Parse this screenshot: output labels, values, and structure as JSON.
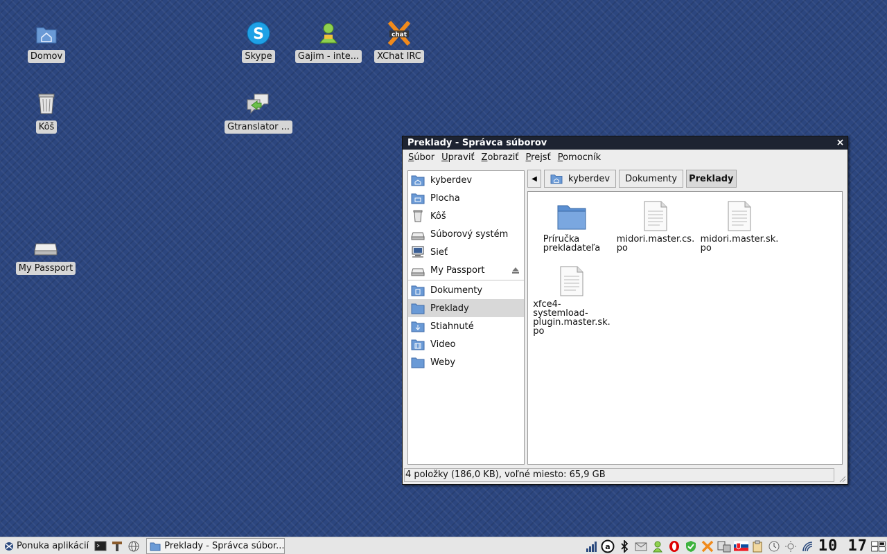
{
  "desktop": {
    "icons": [
      {
        "label": "Domov"
      },
      {
        "label": "Kôš"
      },
      {
        "label": "My Passport"
      },
      {
        "label": "Skype"
      },
      {
        "label": "Gtranslator ..."
      },
      {
        "label": "Gajim - inte..."
      },
      {
        "label": "XChat IRC"
      }
    ]
  },
  "window": {
    "title": "Preklady - Správca súborov",
    "close_glyph": "×",
    "menu": [
      {
        "underline": "S",
        "rest": "úbor"
      },
      {
        "underline": "U",
        "rest": "praviť"
      },
      {
        "underline": "Z",
        "rest": "obraziť"
      },
      {
        "underline": "P",
        "rest": "rejsť"
      },
      {
        "underline": "P",
        "rest": "omocník"
      }
    ],
    "sidebar": {
      "places": [
        {
          "label": "kyberdev",
          "icon": "home-folder-icon"
        },
        {
          "label": "Plocha",
          "icon": "desktop-folder-icon"
        },
        {
          "label": "Kôš",
          "icon": "trash-icon"
        },
        {
          "label": "Súborový systém",
          "icon": "drive-icon"
        },
        {
          "label": "Sieť",
          "icon": "network-icon"
        },
        {
          "label": "My Passport",
          "icon": "drive-icon"
        }
      ],
      "bookmarks": [
        {
          "label": "Dokumenty",
          "icon": "documents-folder-icon"
        },
        {
          "label": "Preklady",
          "icon": "folder-icon",
          "selected": true
        },
        {
          "label": "Stiahnuté",
          "icon": "downloads-folder-icon"
        },
        {
          "label": "Video",
          "icon": "video-folder-icon"
        },
        {
          "label": "Weby",
          "icon": "folder-icon"
        }
      ]
    },
    "pathbar": {
      "back_glyph": "◀",
      "crumbs": [
        "kyberdev",
        "Dokumenty",
        "Preklady"
      ]
    },
    "files": [
      {
        "name_lines": [
          "Príručka",
          "prekladateľa"
        ],
        "type": "folder"
      },
      {
        "name_lines": [
          "midori.master.cs.",
          "po"
        ],
        "type": "file"
      },
      {
        "name_lines": [
          "midori.master.sk.",
          "po"
        ],
        "type": "file"
      },
      {
        "name_lines": [
          "xfce4-",
          "systemload-",
          "plugin.master.sk.",
          "po"
        ],
        "type": "file"
      }
    ],
    "status": "4 položky (186,0 KB), voľné miesto: 65,9 GB"
  },
  "taskbar": {
    "app_menu_label": "Ponuka aplikácií",
    "task_label": "Preklady - Správca súbor...",
    "clock": "10 17"
  },
  "colors": {
    "desktop_bg": "#2c467f",
    "titlebar": "#1d2331",
    "folder_blue": "#5b8fd1"
  }
}
